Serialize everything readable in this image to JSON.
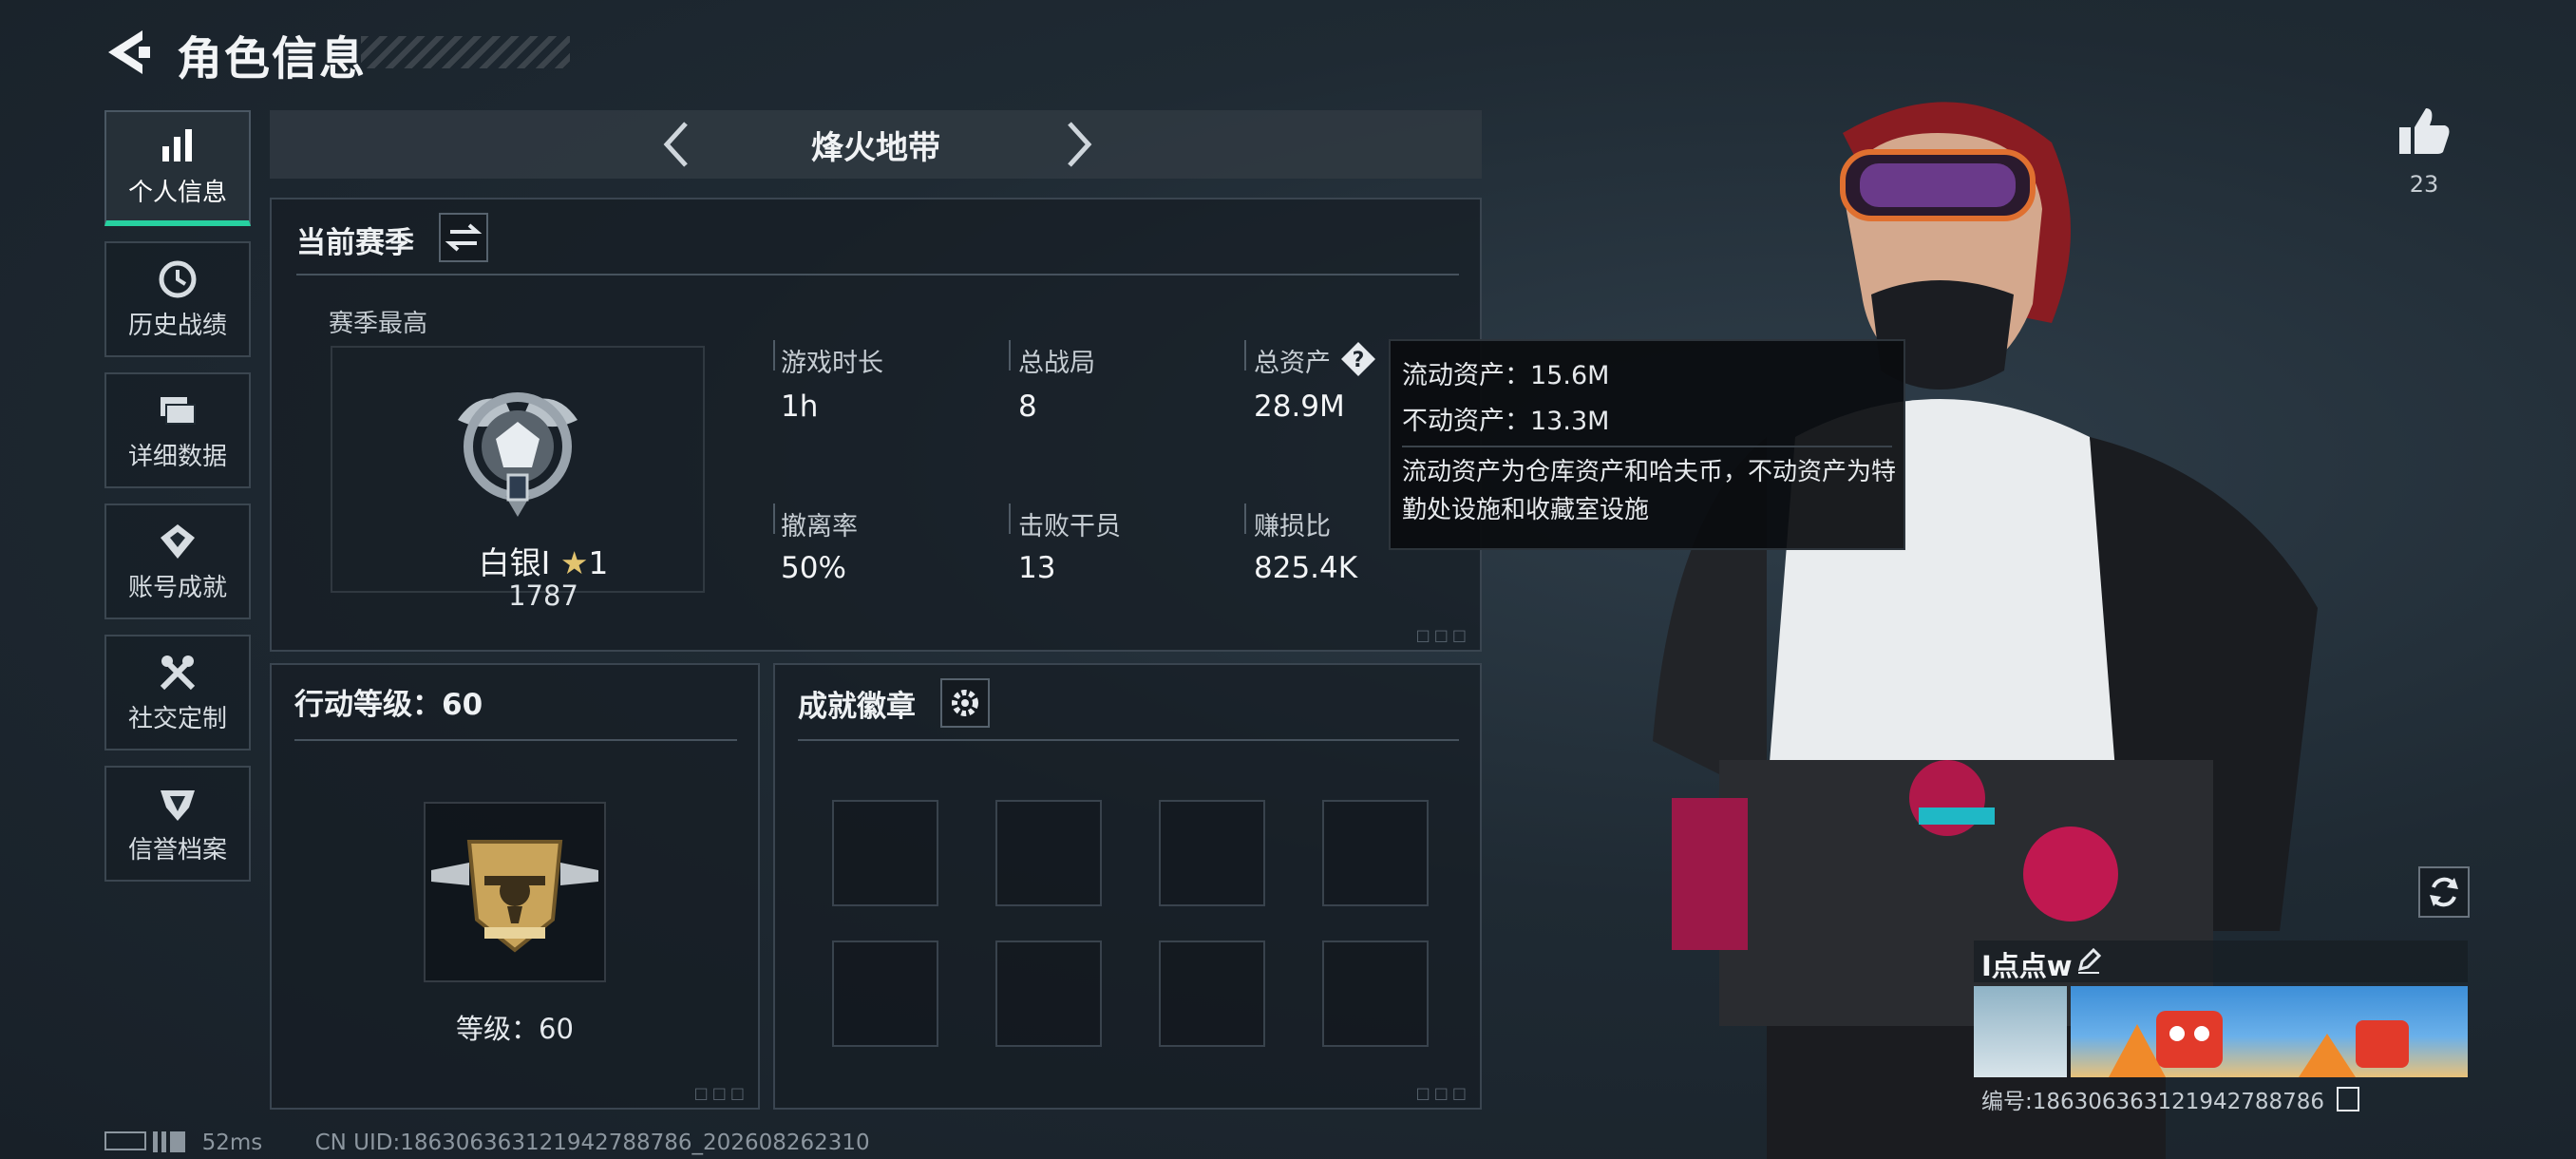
{
  "header": {
    "title": "角色信息",
    "back_icon": "back-arrow-icon"
  },
  "sidebar": {
    "items": [
      {
        "label": "个人信息",
        "icon": "bar-chart-icon",
        "active": true
      },
      {
        "label": "历史战绩",
        "icon": "clock-icon",
        "active": false
      },
      {
        "label": "详细数据",
        "icon": "folders-icon",
        "active": false
      },
      {
        "label": "账号成就",
        "icon": "achievement-icon",
        "active": false
      },
      {
        "label": "社交定制",
        "icon": "tools-icon",
        "active": false
      },
      {
        "label": "信誉档案",
        "icon": "reputation-icon",
        "active": false
      }
    ]
  },
  "map_selector": {
    "name": "烽火地带"
  },
  "season": {
    "title": "当前赛季",
    "best_label": "赛季最高",
    "rank_name": "白银I",
    "rank_stars": "1",
    "rank_score": "1787",
    "stats": [
      {
        "label": "游戏时长",
        "value": "1h"
      },
      {
        "label": "总战局",
        "value": "8"
      },
      {
        "label": "总资产",
        "value": "28.9M"
      },
      {
        "label": "撤离率",
        "value": "50%"
      },
      {
        "label": "击败干员",
        "value": "13"
      },
      {
        "label": "赚损比",
        "value": "825.4K"
      }
    ]
  },
  "tooltip": {
    "liquid": "流动资产：15.6M",
    "fixed": "不动资产：13.3M",
    "desc": "流动资产为仓库资产和哈夫币，不动资产为特勤处设施和收藏室设施"
  },
  "action_level": {
    "title": "行动等级：60",
    "level_text": "等级：60"
  },
  "achievements": {
    "title": "成就徽章",
    "slot_count": 8
  },
  "like": {
    "count": "23"
  },
  "player": {
    "name": "I点点w",
    "id_text": "编号:18630636312194278878​6"
  },
  "footer": {
    "ping": "52ms",
    "uid": "CN UID:18630636312194278878​6_202608262310"
  },
  "colors": {
    "accent": "#27d1a0",
    "panel_border": "#3a4550"
  }
}
